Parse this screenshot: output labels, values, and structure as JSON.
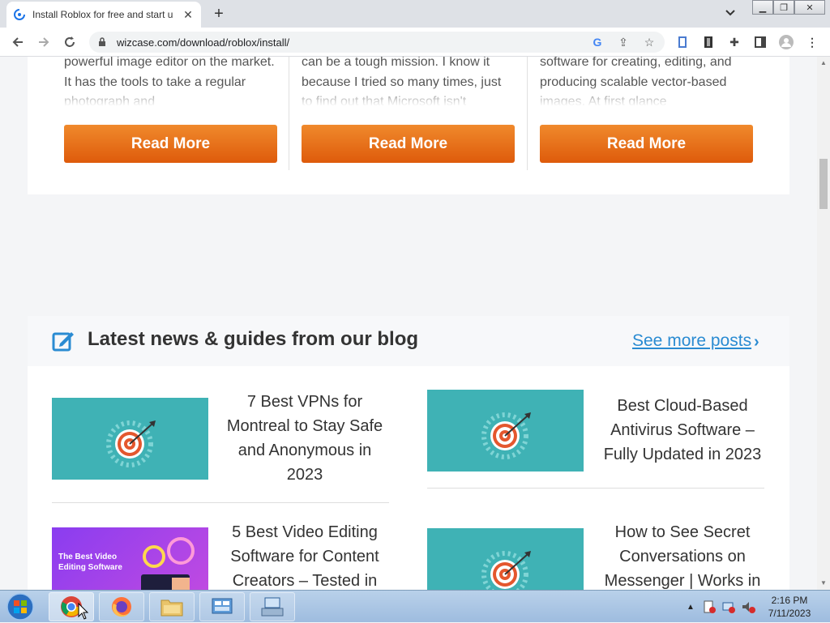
{
  "browser": {
    "tab_title": "Install Roblox for free and start u",
    "url": "wizcase.com/download/roblox/install/"
  },
  "cards": [
    {
      "text": "powerful image editor on the market. It has the tools to take a regular photograph and",
      "button": "Read More"
    },
    {
      "text": "can be a tough mission. I know it because I tried so many times, just to find out that Microsoft isn't",
      "button": "Read More"
    },
    {
      "text": "software for creating, editing, and producing scalable vector-based images. At first glance",
      "button": "Read More"
    }
  ],
  "blog": {
    "heading": "Latest news & guides from our blog",
    "see_more": "See more posts",
    "posts": [
      {
        "title": "7 Best VPNs for Montreal to Stay Safe and Anonymous in 2023",
        "thumb": "target-icon"
      },
      {
        "title": "Best Cloud-Based Antivirus Software – Fully Updated in 2023",
        "thumb": "target-icon"
      },
      {
        "title": "5 Best Video Editing Software for Content Creators – Tested in",
        "thumb": "video-editing-banner",
        "thumb_text": "The Best Video Editing Software"
      },
      {
        "title": "How to See Secret Conversations on Messenger | Works in",
        "thumb": "target-icon"
      }
    ]
  },
  "taskbar": {
    "time": "2:16 PM",
    "date": "7/11/2023"
  },
  "colors": {
    "accent_orange": "#e8711a",
    "link_blue": "#2a8bd2",
    "thumb_teal": "#3fb2b5"
  }
}
